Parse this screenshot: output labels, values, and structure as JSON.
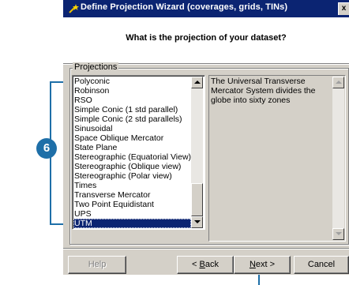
{
  "window": {
    "title": "Define Projection Wizard (coverages, grids, TINs)",
    "close_glyph": "x"
  },
  "header": {
    "question": "What is the projection of your dataset?"
  },
  "projections": {
    "group_label": "Projections",
    "items": [
      "Polyconic",
      "Robinson",
      "RSO",
      "Simple Conic (1 std parallel)",
      "Simple Conic (2 std parallels)",
      "Sinusoidal",
      "Space Oblique Mercator",
      "State Plane",
      "Stereographic (Equatorial View)",
      "Stereographic (Oblique view)",
      "Stereographic (Polar view)",
      "Times",
      "Transverse Mercator",
      "Two Point Equidistant",
      "UPS",
      "UTM"
    ],
    "selected": "UTM",
    "description": "The Universal Transverse Mercator System divides the globe into sixty zones"
  },
  "buttons": {
    "help": "Help",
    "back_prefix": "< ",
    "back_key": "B",
    "back_rest": "ack",
    "next_key": "N",
    "next_rest": "ext >",
    "cancel": "Cancel"
  },
  "callout": {
    "step_number": "6",
    "color": "#1e6fa8"
  },
  "colors": {
    "titlebar": "#0b2472",
    "dialog": "#d4d0c8",
    "selection": "#0b2472"
  }
}
